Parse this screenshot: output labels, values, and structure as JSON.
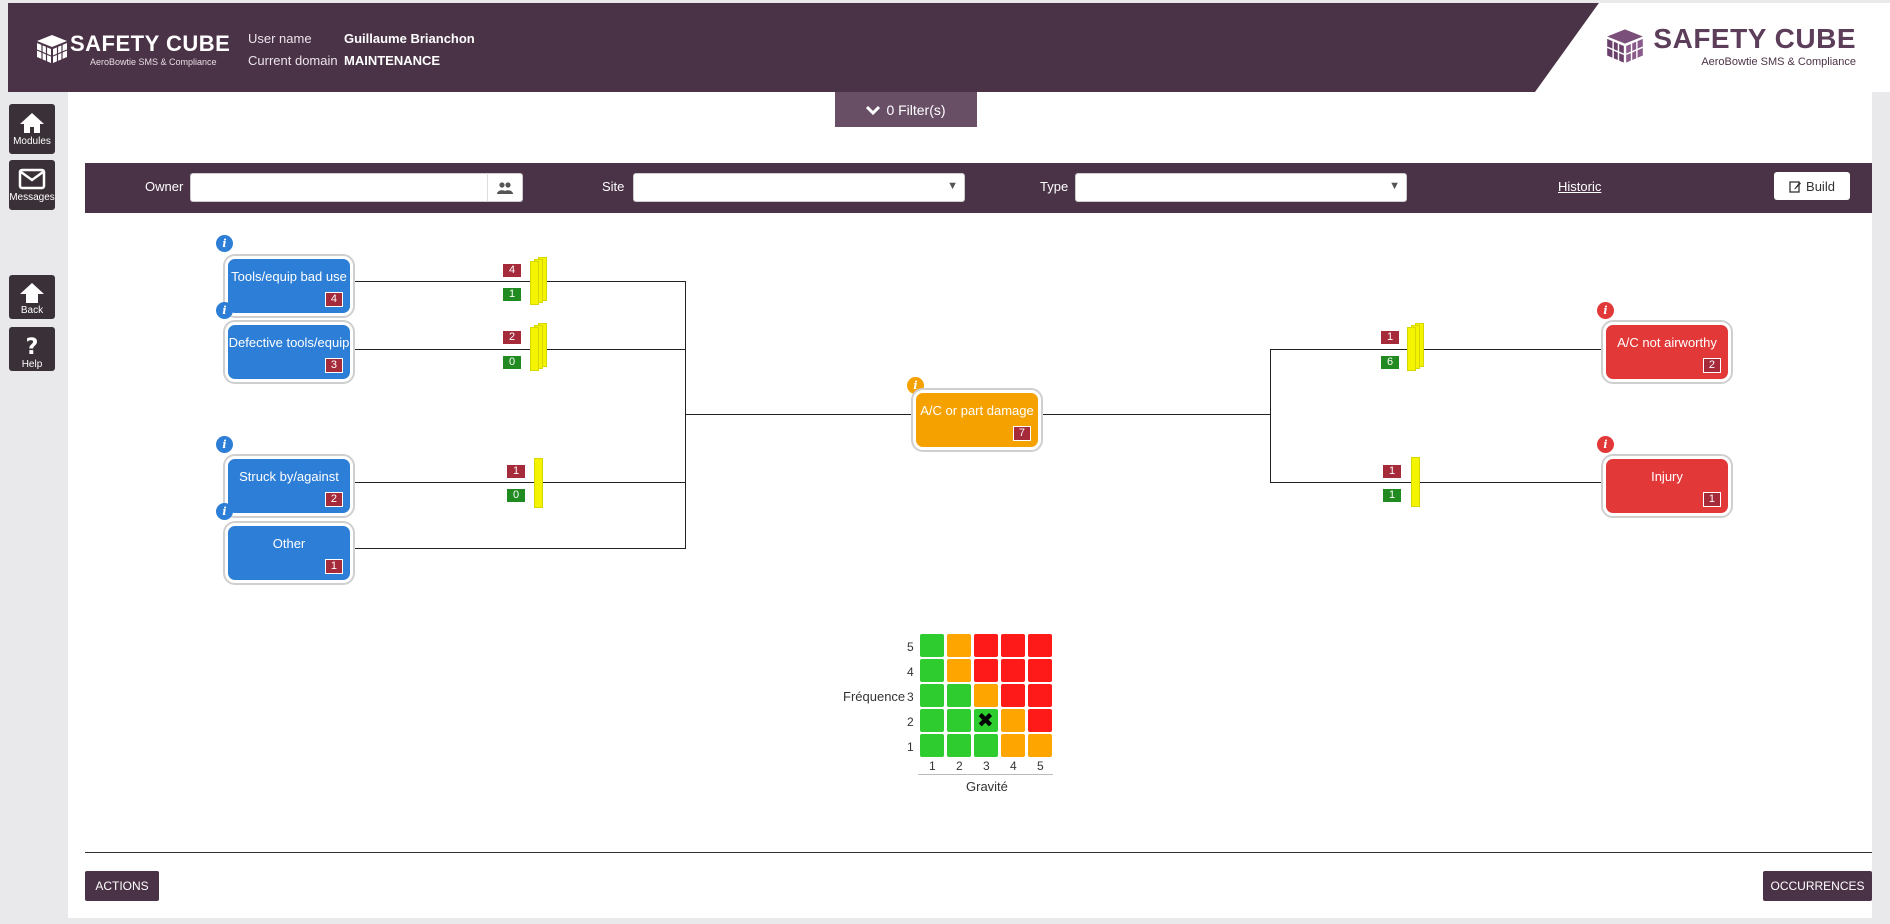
{
  "header": {
    "brand": "SAFETY CUBE",
    "brand_sub": "AeroBowtie SMS & Compliance",
    "user_label": "User name",
    "user_value": "Guillaume Brianchon",
    "domain_label": "Current domain",
    "domain_value": "MAINTENANCE"
  },
  "sidebar": [
    {
      "label": "Modules",
      "icon": "home-icon"
    },
    {
      "label": "Messages",
      "icon": "envelope-icon"
    },
    {
      "label": "Back",
      "icon": "arrow-up-icon"
    },
    {
      "label": "Help",
      "icon": "question-icon"
    }
  ],
  "filters": {
    "label": "0 Filter(s)"
  },
  "toolbar": {
    "owner_label": "Owner",
    "owner_value": "",
    "site_label": "Site",
    "site_value": "",
    "type_label": "Type",
    "type_value": "",
    "historic": "Historic",
    "build": "Build"
  },
  "bowtie": {
    "threats": [
      {
        "label": "Tools/equip bad use",
        "count": "4",
        "barrier_red": "4",
        "barrier_green": "1"
      },
      {
        "label": "Defective tools/equip",
        "count": "3",
        "barrier_red": "2",
        "barrier_green": "0"
      },
      {
        "label": "Struck by/against",
        "count": "2",
        "barrier_red": "1",
        "barrier_green": "0"
      },
      {
        "label": "Other",
        "count": "1"
      }
    ],
    "event": {
      "label": "A/C or part damage",
      "count": "7"
    },
    "consequences": [
      {
        "label": "A/C not airworthy",
        "count": "2",
        "barrier_red": "1",
        "barrier_green": "6"
      },
      {
        "label": "Injury",
        "count": "1",
        "barrier_red": "1",
        "barrier_green": "1"
      }
    ]
  },
  "matrix": {
    "y_title": "Fréquence",
    "x_title": "Gravité",
    "y_ticks": [
      "5",
      "4",
      "3",
      "2",
      "1"
    ],
    "x_ticks": [
      "1",
      "2",
      "3",
      "4",
      "5"
    ],
    "marker": "✖",
    "colors": {
      "green": "#2ecc2e",
      "orange": "#ffa500",
      "red": "#ff1a1a"
    },
    "grid": [
      [
        "green",
        "orange",
        "red",
        "red",
        "red"
      ],
      [
        "green",
        "orange",
        "red",
        "red",
        "red"
      ],
      [
        "green",
        "green",
        "orange",
        "red",
        "red"
      ],
      [
        "green",
        "green",
        "green",
        "orange",
        "red"
      ],
      [
        "green",
        "green",
        "green",
        "orange",
        "orange"
      ]
    ],
    "marked_cell": {
      "frequence": 2,
      "gravite": 3
    }
  },
  "footer": {
    "actions": "ACTIONS",
    "occurrences": "OCCURRENCES"
  }
}
